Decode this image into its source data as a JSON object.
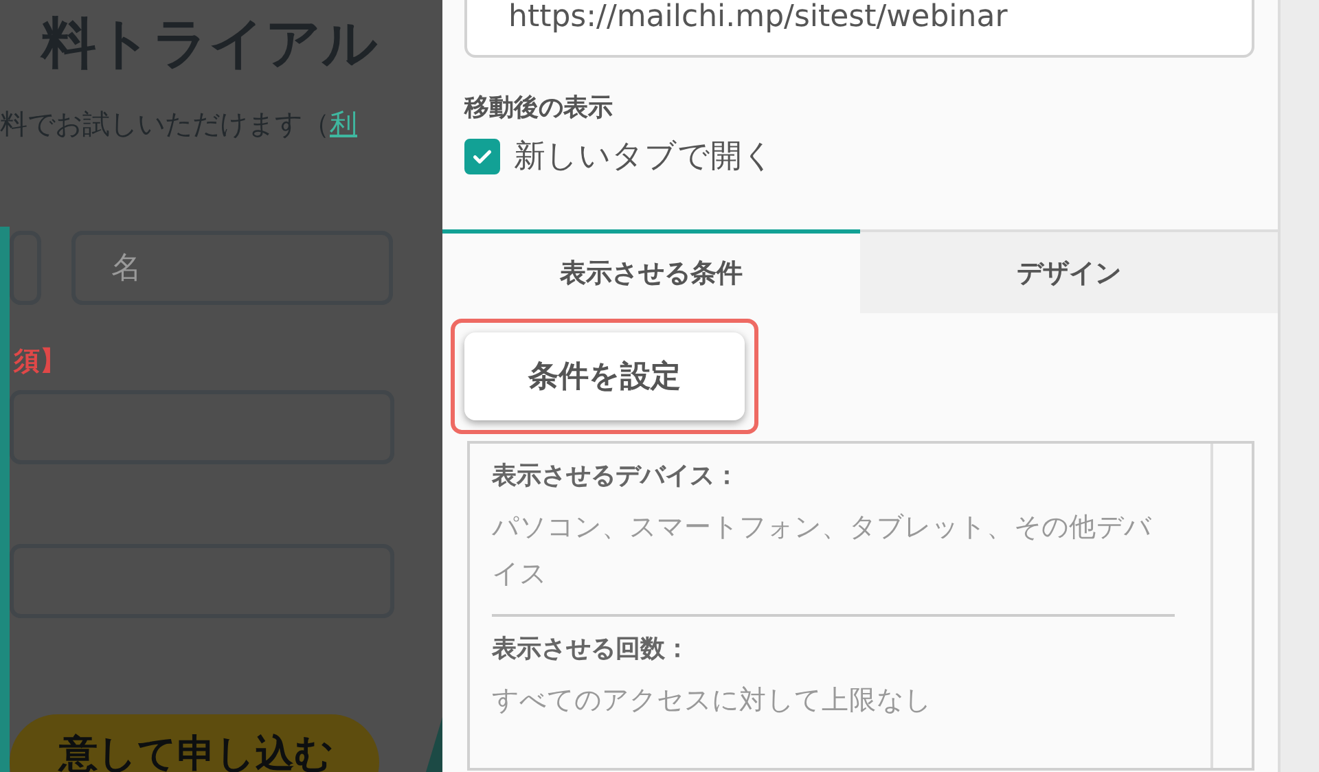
{
  "background_page": {
    "title": "料トライアル",
    "intro": "料でお試しいただけます（",
    "intro_link": "利",
    "fields": [
      {
        "kind": "cut"
      },
      {
        "kind": "full",
        "placeholder": "名"
      }
    ],
    "required_label": "須】",
    "submit": "意して申し込む"
  },
  "panel": {
    "url_field": {
      "value": "https://mailchi.mp/sitest/webinar"
    },
    "after_move_label": "移動後の表示",
    "open_new_tab": {
      "label": "新しいタブで開く",
      "checked": true
    },
    "tabs": [
      {
        "label": "表示させる条件",
        "selected": true
      },
      {
        "label": "デザイン",
        "selected": false
      }
    ],
    "set_conditions_button": {
      "label": "条件を設定",
      "highlighted": true
    },
    "conditions": [
      {
        "heading": "表示させるデバイス：",
        "value": "パソコン、スマートフォン、タブレット、その他デバイス"
      },
      {
        "heading": "表示させる回数：",
        "value": "すべてのアクセスに対して上限なし"
      }
    ]
  }
}
